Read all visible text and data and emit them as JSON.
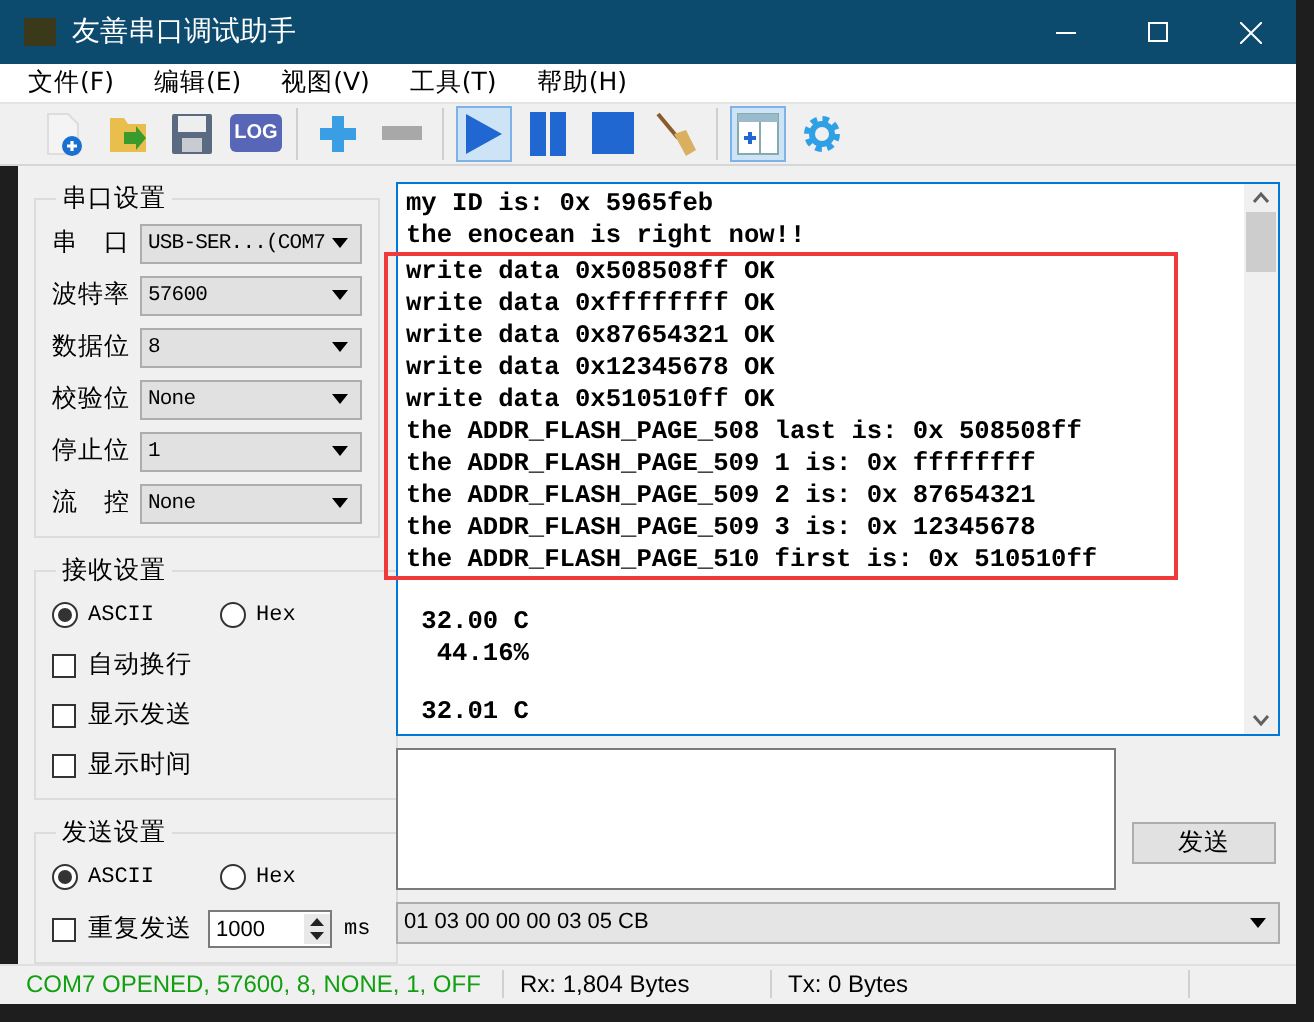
{
  "window": {
    "title": "友善串口调试助手"
  },
  "menu": [
    "文件(F)",
    "编辑(E)",
    "视图(V)",
    "工具(T)",
    "帮助(H)"
  ],
  "toolbar": [
    {
      "kind": "new",
      "pressed": false
    },
    {
      "kind": "open",
      "pressed": false
    },
    {
      "kind": "save",
      "pressed": false
    },
    {
      "kind": "log",
      "label": "LOG",
      "pressed": false
    },
    {
      "kind": "sep"
    },
    {
      "kind": "add",
      "pressed": false
    },
    {
      "kind": "remove",
      "pressed": false
    },
    {
      "kind": "sep"
    },
    {
      "kind": "play",
      "pressed": true
    },
    {
      "kind": "pause",
      "pressed": false
    },
    {
      "kind": "stop",
      "pressed": false
    },
    {
      "kind": "broom",
      "pressed": false
    },
    {
      "kind": "sep"
    },
    {
      "kind": "panel",
      "pressed": true
    },
    {
      "kind": "gear",
      "pressed": false
    }
  ],
  "port_settings": {
    "title": "串口设置",
    "rows": [
      {
        "label": "串　口",
        "value": "USB-SER...(COM7"
      },
      {
        "label": "波特率",
        "value": "57600"
      },
      {
        "label": "数据位",
        "value": "8"
      },
      {
        "label": "校验位",
        "value": "None"
      },
      {
        "label": "停止位",
        "value": "1"
      },
      {
        "label": "流　控",
        "value": "None"
      }
    ]
  },
  "receive_settings": {
    "title": "接收设置",
    "modes": [
      {
        "label": "ASCII",
        "selected": true
      },
      {
        "label": "Hex",
        "selected": false
      }
    ],
    "options": [
      {
        "label": "自动换行",
        "checked": false
      },
      {
        "label": "显示发送",
        "checked": false
      },
      {
        "label": "显示时间",
        "checked": false
      }
    ]
  },
  "send_settings": {
    "title": "发送设置",
    "modes": [
      {
        "label": "ASCII",
        "selected": true
      },
      {
        "label": "Hex",
        "selected": false
      }
    ],
    "repeat": {
      "label": "重复发送",
      "checked": false,
      "value": "1000",
      "unit": "ms"
    }
  },
  "receive_log": {
    "paragraphs": [
      {
        "blocks": [
          {
            "boxed": false,
            "lines": [
              "my ID is: 0x 5965feb",
              "the enocean is right now!!"
            ]
          },
          {
            "boxed": true,
            "lines": [
              "write data 0x508508ff OK",
              "write data 0xffffffff OK",
              "write data 0x87654321 OK",
              "write data 0x12345678 OK",
              "write data 0x510510ff OK",
              "the ADDR_FLASH_PAGE_508 last is: 0x 508508ff",
              "the ADDR_FLASH_PAGE_509 1 is: 0x ffffffff",
              "the ADDR_FLASH_PAGE_509 2 is: 0x 87654321",
              "the ADDR_FLASH_PAGE_509 3 is: 0x 12345678",
              "the ADDR_FLASH_PAGE_510 first is: 0x 510510ff"
            ]
          }
        ]
      },
      {
        "blocks": [
          {
            "boxed": false,
            "lines": [
              " 32.00 C",
              "  44.16%"
            ]
          }
        ]
      },
      {
        "blocks": [
          {
            "boxed": false,
            "lines": [
              " 32.01 C"
            ]
          }
        ]
      }
    ]
  },
  "send_button": "发送",
  "history": {
    "value": "01 03 00 00 00 03 05 CB"
  },
  "status_bar": [
    "COM7 OPENED, 57600, 8, NONE, 1, OFF",
    "Rx: 1,804 Bytes",
    "Tx: 0 Bytes"
  ]
}
